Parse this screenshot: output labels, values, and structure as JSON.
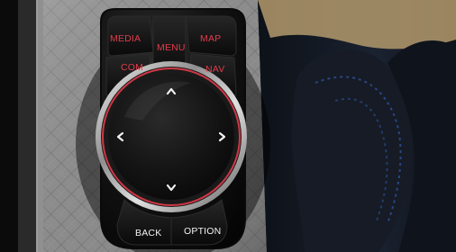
{
  "controller": {
    "buttons": {
      "media": "MEDIA",
      "menu": "MENU",
      "map": "MAP",
      "com": "COM",
      "nav": "NAV",
      "back": "BACK",
      "option": "OPTION"
    }
  },
  "colors": {
    "accent_red": "#e23b4a",
    "button_black": "#111111",
    "console_panel": "#8d8d8d",
    "seat_leather": "#1a1f2a",
    "seat_stitch": "#2d4d95"
  },
  "icons": {
    "up": "chevron-up-icon",
    "down": "chevron-down-icon",
    "left": "chevron-left-icon",
    "right": "chevron-right-icon"
  }
}
